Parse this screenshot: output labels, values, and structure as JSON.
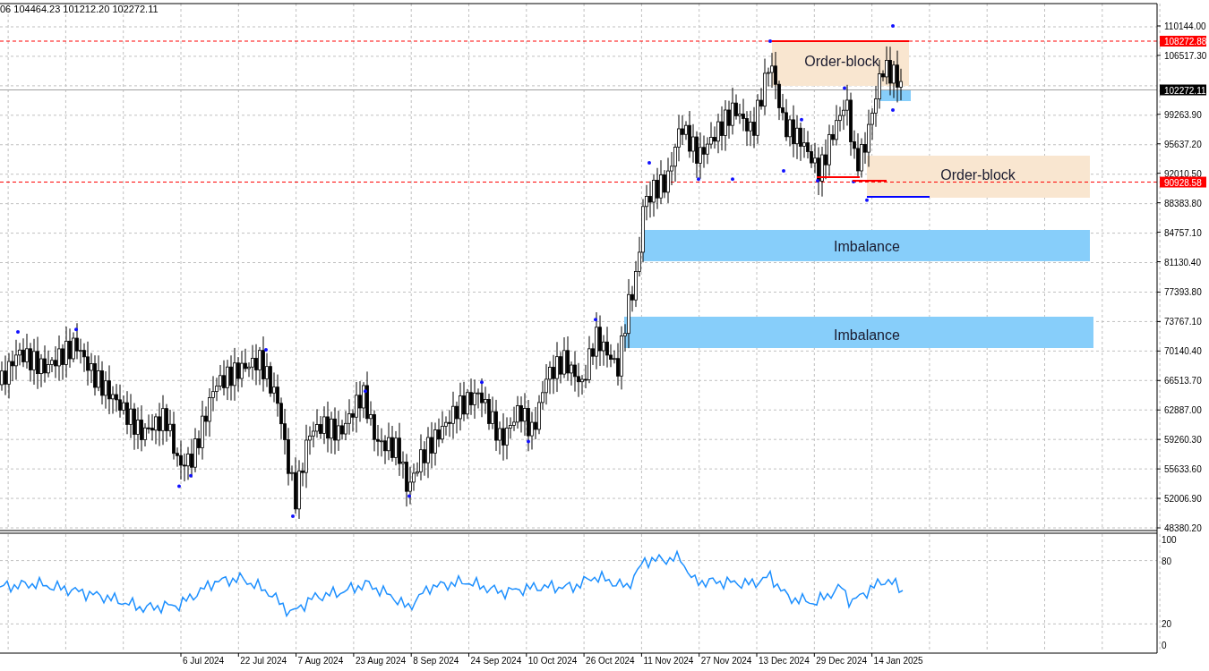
{
  "header": {
    "ohlc": "06 104464.23 101212.20 102272.11"
  },
  "price_axis": {
    "ticks": [
      "110144.00",
      "106517.30",
      "99263.90",
      "95637.20",
      "92010.50",
      "88383.80",
      "84757.10",
      "81130.40",
      "77393.80",
      "73767.10",
      "70140.40",
      "66513.70",
      "62887.00",
      "59260.30",
      "55633.60",
      "52006.90",
      "48380.20"
    ],
    "markers": [
      {
        "kind": "level",
        "label": "108272.88"
      },
      {
        "kind": "bid",
        "label": "102272.11"
      },
      {
        "kind": "level",
        "label": "90928.58"
      }
    ]
  },
  "zones": [
    {
      "kind": "order-block",
      "label": "Order-block"
    },
    {
      "kind": "imbalance-small"
    },
    {
      "kind": "order-block",
      "label": "Order-block"
    },
    {
      "kind": "imbalance",
      "label": "Imbalance"
    },
    {
      "kind": "imbalance",
      "label": "Imbalance"
    }
  ],
  "indicator": {
    "ticks": [
      "100",
      "80",
      "20",
      "0"
    ]
  },
  "time_axis": {
    "labels": [
      "6 Jul 2024",
      "22 Jul 2024",
      "7 Aug 2024",
      "23 Aug 2024",
      "8 Sep 2024",
      "24 Sep 2024",
      "10 Oct 2024",
      "26 Oct 2024",
      "11 Nov 2024",
      "27 Nov 2024",
      "13 Dec 2024",
      "29 Dec 2024",
      "14 Jan 2025"
    ]
  }
}
